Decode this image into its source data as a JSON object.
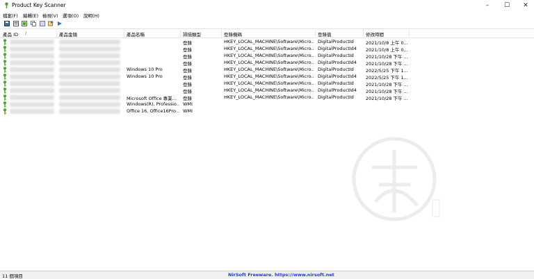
{
  "window": {
    "title": "Product Key Scanner"
  },
  "menu": [
    "檔案(F)",
    "編輯(E)",
    "檢視(V)",
    "選項(O)",
    "說明(H)"
  ],
  "columns": [
    "產品 ID",
    "產品金鑰",
    "產品名稱",
    "掃描類型",
    "登錄機碼",
    "登錄值",
    "修改時間"
  ],
  "rows": [
    {
      "name": "",
      "type": "登錄",
      "key": "HKEY_LOCAL_MACHINE\\Software\\Micro...",
      "value": "DigitalProductId",
      "time": "2021/10/8 上午 0..."
    },
    {
      "name": "",
      "type": "登錄",
      "key": "HKEY_LOCAL_MACHINE\\Software\\Micro...",
      "value": "DigitalProductId4",
      "time": "2021/10/8 上午 0..."
    },
    {
      "name": "",
      "type": "登錄",
      "key": "HKEY_LOCAL_MACHINE\\Software\\Micro...",
      "value": "DigitalProductId",
      "time": "2021/10/28 下午 ..."
    },
    {
      "name": "",
      "type": "登錄",
      "key": "HKEY_LOCAL_MACHINE\\Software\\Micro...",
      "value": "DigitalProductId4",
      "time": "2021/10/28 下午 ..."
    },
    {
      "name": "Windows 10 Pro",
      "type": "登錄",
      "key": "HKEY_LOCAL_MACHINE\\Software\\Micro...",
      "value": "DigitalProductId",
      "time": "2022/5/25 下午 1..."
    },
    {
      "name": "Windows 10 Pro",
      "type": "登錄",
      "key": "HKEY_LOCAL_MACHINE\\Software\\Micro...",
      "value": "DigitalProductId4",
      "time": "2022/5/25 下午 1..."
    },
    {
      "name": "",
      "type": "登錄",
      "key": "HKEY_LOCAL_MACHINE\\Software\\Micro...",
      "value": "DigitalProductId",
      "time": "2021/10/28 下午 ..."
    },
    {
      "name": "",
      "type": "登錄",
      "key": "HKEY_LOCAL_MACHINE\\Software\\Micro...",
      "value": "DigitalProductId4",
      "time": "2021/10/28 下午 ..."
    },
    {
      "name": "Microsoft Office 專業...",
      "type": "登錄",
      "key": "HKEY_LOCAL_MACHINE\\Software\\Micro...",
      "value": "DigitalProductId",
      "time": "2021/10/28 下午 ..."
    },
    {
      "name": "Windows(R), Professio...",
      "type": "WMI",
      "key": "",
      "value": "",
      "time": ""
    },
    {
      "name": "Office 16, Office16Pro...",
      "type": "WMI",
      "key": "",
      "value": "",
      "time": ""
    }
  ],
  "status": {
    "count": "11 個項目",
    "link": "NirSoft Freeware. https://www.nirsoft.net"
  },
  "icons": {
    "app": "key-icon",
    "row": "green-key-icon"
  },
  "colors": {
    "key": "#4aa22c",
    "link": "#1a3dd6",
    "watermark": "#ececec"
  }
}
